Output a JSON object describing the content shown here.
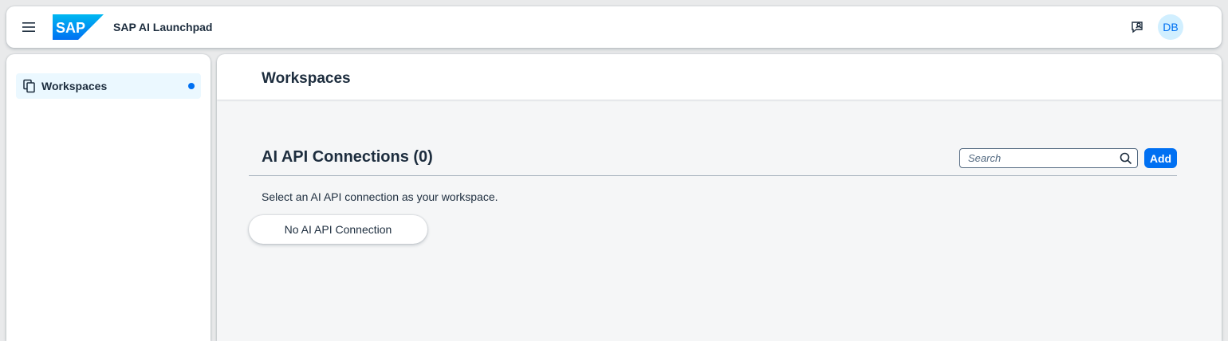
{
  "shell": {
    "logo_text": "SAP",
    "app_title": "SAP AI Launchpad",
    "avatar_initials": "DB",
    "brand_color": "#0070f2"
  },
  "sidebar": {
    "items": [
      {
        "label": "Workspaces",
        "icon": "copy-icon",
        "selected": true
      }
    ]
  },
  "main": {
    "page_title": "Workspaces",
    "section_title": "AI API Connections (0)",
    "search": {
      "placeholder": "Search",
      "value": ""
    },
    "add_label": "Add",
    "description": "Select an AI API connection as your workspace.",
    "empty_item_label": "No AI API Connection"
  }
}
